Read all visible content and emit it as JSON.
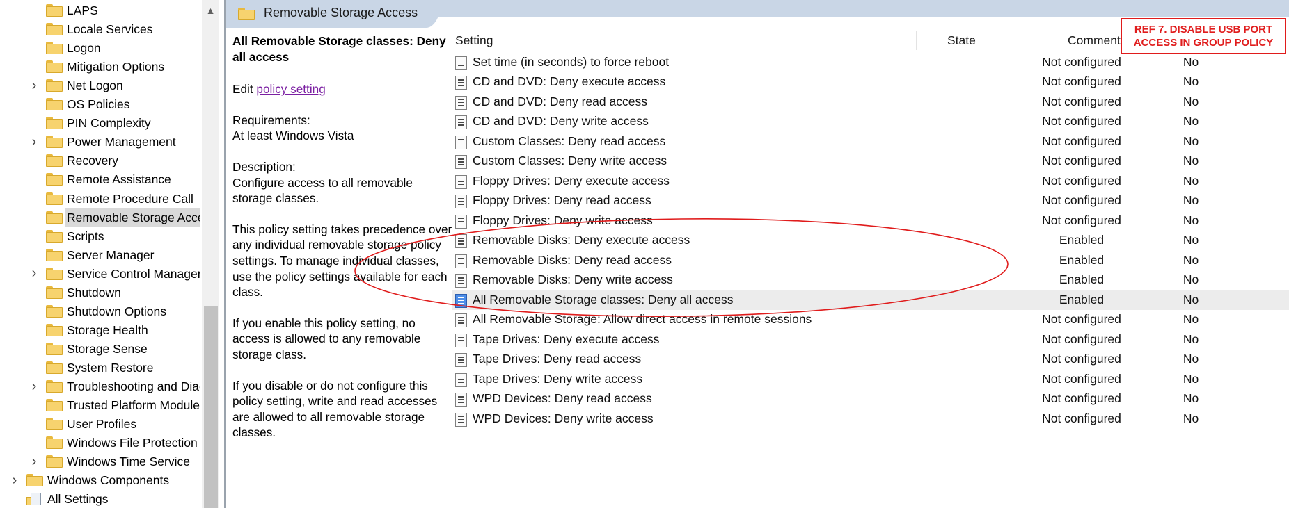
{
  "tree": {
    "items": [
      {
        "label": "LAPS",
        "expandable": false,
        "icon": "folder-icon"
      },
      {
        "label": "Locale Services",
        "expandable": false,
        "icon": "folder-icon"
      },
      {
        "label": "Logon",
        "expandable": false,
        "icon": "folder-icon"
      },
      {
        "label": "Mitigation Options",
        "expandable": false,
        "icon": "folder-icon"
      },
      {
        "label": "Net Logon",
        "expandable": true,
        "icon": "folder-icon"
      },
      {
        "label": "OS Policies",
        "expandable": false,
        "icon": "folder-icon"
      },
      {
        "label": "PIN Complexity",
        "expandable": false,
        "icon": "folder-icon"
      },
      {
        "label": "Power Management",
        "expandable": true,
        "icon": "folder-icon"
      },
      {
        "label": "Recovery",
        "expandable": false,
        "icon": "folder-icon"
      },
      {
        "label": "Remote Assistance",
        "expandable": false,
        "icon": "folder-icon"
      },
      {
        "label": "Remote Procedure Call",
        "expandable": false,
        "icon": "folder-icon"
      },
      {
        "label": "Removable Storage Access",
        "expandable": false,
        "icon": "folder-icon",
        "selected": true
      },
      {
        "label": "Scripts",
        "expandable": false,
        "icon": "folder-icon"
      },
      {
        "label": "Server Manager",
        "expandable": false,
        "icon": "folder-icon"
      },
      {
        "label": "Service Control Manager",
        "expandable": true,
        "icon": "folder-icon"
      },
      {
        "label": "Shutdown",
        "expandable": false,
        "icon": "folder-icon"
      },
      {
        "label": "Shutdown Options",
        "expandable": false,
        "icon": "folder-icon"
      },
      {
        "label": "Storage Health",
        "expandable": false,
        "icon": "folder-icon"
      },
      {
        "label": "Storage Sense",
        "expandable": false,
        "icon": "folder-icon"
      },
      {
        "label": "System Restore",
        "expandable": false,
        "icon": "folder-icon"
      },
      {
        "label": "Troubleshooting and Diagnostics",
        "expandable": true,
        "icon": "folder-icon"
      },
      {
        "label": "Trusted Platform Module Services",
        "expandable": false,
        "icon": "folder-icon"
      },
      {
        "label": "User Profiles",
        "expandable": false,
        "icon": "folder-icon"
      },
      {
        "label": "Windows File Protection",
        "expandable": false,
        "icon": "folder-icon"
      },
      {
        "label": "Windows Time Service",
        "expandable": true,
        "icon": "folder-icon"
      },
      {
        "label": "Windows Components",
        "expandable": true,
        "icon": "folder-icon",
        "level": 0
      },
      {
        "label": "All Settings",
        "expandable": false,
        "icon": "settings-folder-icon",
        "level": 0
      }
    ]
  },
  "header": {
    "title": "Removable Storage Access"
  },
  "description": {
    "title": "All Removable Storage classes: Deny all access",
    "edit_prefix": "Edit",
    "edit_link": "policy setting ",
    "requirements_label": "Requirements:",
    "requirements_value": "At least Windows Vista",
    "description_label": "Description:",
    "description_text": "Configure access to all removable storage classes.",
    "para1": "This policy setting takes precedence over any individual removable storage policy settings. To manage individual classes, use the policy settings available for each class.",
    "para2": "If you enable this policy setting, no access is allowed to any removable storage class.",
    "para3": "If you disable or do not configure this policy setting, write and read accesses are allowed to all removable storage classes."
  },
  "table": {
    "columns": [
      "Setting",
      "State",
      "Comment"
    ],
    "rows": [
      {
        "setting": "Set time (in seconds) to force reboot",
        "state": "Not configured",
        "comment": "No"
      },
      {
        "setting": "CD and DVD: Deny execute access",
        "state": "Not configured",
        "comment": "No"
      },
      {
        "setting": "CD and DVD: Deny read access",
        "state": "Not configured",
        "comment": "No"
      },
      {
        "setting": "CD and DVD: Deny write access",
        "state": "Not configured",
        "comment": "No"
      },
      {
        "setting": "Custom Classes: Deny read access",
        "state": "Not configured",
        "comment": "No"
      },
      {
        "setting": "Custom Classes: Deny write access",
        "state": "Not configured",
        "comment": "No"
      },
      {
        "setting": "Floppy Drives: Deny execute access",
        "state": "Not configured",
        "comment": "No"
      },
      {
        "setting": "Floppy Drives: Deny read access",
        "state": "Not configured",
        "comment": "No"
      },
      {
        "setting": "Floppy Drives: Deny write access",
        "state": "Not configured",
        "comment": "No"
      },
      {
        "setting": "Removable Disks: Deny execute access",
        "state": "Enabled",
        "comment": "No"
      },
      {
        "setting": "Removable Disks: Deny read access",
        "state": "Enabled",
        "comment": "No"
      },
      {
        "setting": "Removable Disks: Deny write access",
        "state": "Enabled",
        "comment": "No"
      },
      {
        "setting": "All Removable Storage classes: Deny all access",
        "state": "Enabled",
        "comment": "No",
        "selected": true
      },
      {
        "setting": "All Removable Storage: Allow direct access in remote sessions",
        "state": "Not configured",
        "comment": "No"
      },
      {
        "setting": "Tape Drives: Deny execute access",
        "state": "Not configured",
        "comment": "No"
      },
      {
        "setting": "Tape Drives: Deny read access",
        "state": "Not configured",
        "comment": "No"
      },
      {
        "setting": "Tape Drives: Deny write access",
        "state": "Not configured",
        "comment": "No"
      },
      {
        "setting": "WPD Devices: Deny read access",
        "state": "Not configured",
        "comment": "No"
      },
      {
        "setting": "WPD Devices: Deny write access",
        "state": "Not configured",
        "comment": "No"
      }
    ]
  },
  "annotation": {
    "ref_text": "REF 7. DISABLE USB PORT ACCESS IN GROUP POLICY",
    "color": "#e01c1c"
  },
  "colors": {
    "header_band": "#c9d6e6",
    "selected_row": "#ececec",
    "link": "#7b1fa2"
  }
}
